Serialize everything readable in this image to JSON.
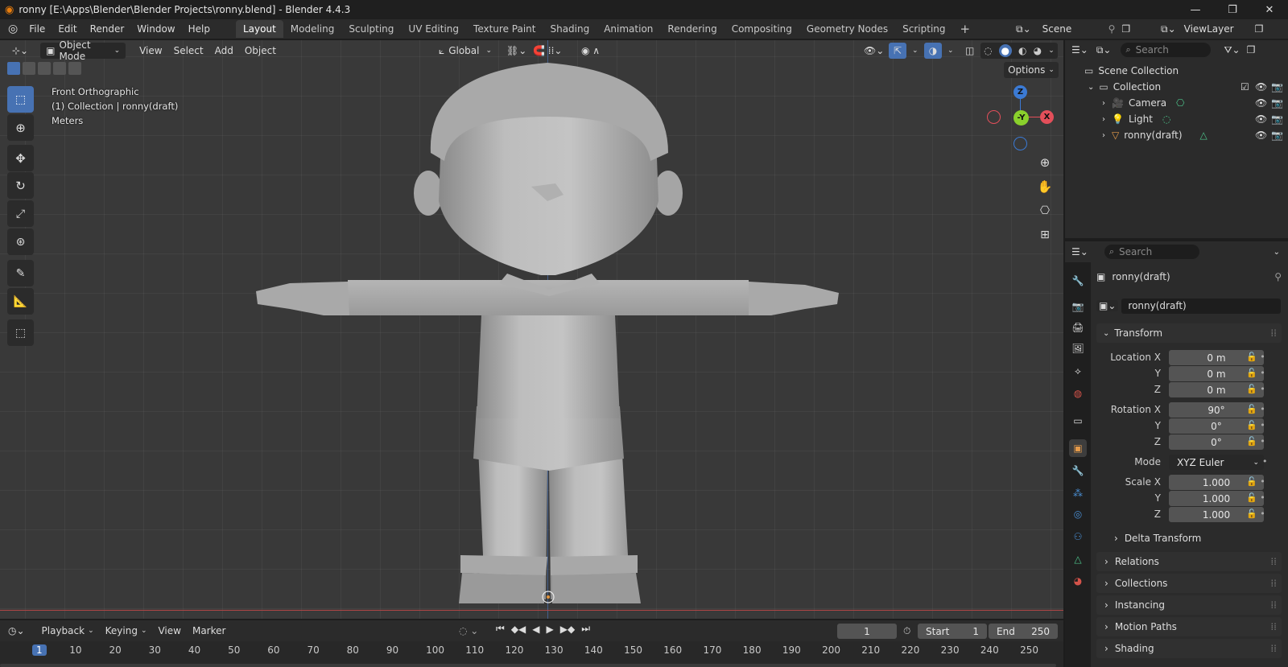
{
  "window": {
    "title": "ronny [E:\\Apps\\Blender\\Blender Projects\\ronny.blend] - Blender 4.4.3",
    "minimize": "—",
    "maximize": "❐",
    "close": "✕"
  },
  "menubar": {
    "items": [
      "File",
      "Edit",
      "Render",
      "Window",
      "Help"
    ],
    "workspaces": [
      "Layout",
      "Modeling",
      "Sculpting",
      "UV Editing",
      "Texture Paint",
      "Shading",
      "Animation",
      "Rendering",
      "Compositing",
      "Geometry Nodes",
      "Scripting"
    ],
    "active_workspace": "Layout",
    "add_workspace": "+",
    "scene": "Scene",
    "view_layer": "ViewLayer"
  },
  "viewport": {
    "mode": "Object Mode",
    "menus": [
      "View",
      "Select",
      "Add",
      "Object"
    ],
    "orientation": "Global",
    "options": "Options",
    "info_line1": "Front Orthographic",
    "info_line2": "(1) Collection | ronny(draft)",
    "info_line3": "Meters",
    "gizmo": {
      "z": "Z",
      "y": "-Y",
      "x": "X"
    }
  },
  "outliner": {
    "search_placeholder": "Search",
    "scene_collection": "Scene Collection",
    "collection": "Collection",
    "objects": [
      "Camera",
      "Light",
      "ronny(draft)"
    ]
  },
  "properties": {
    "search_placeholder": "Search",
    "object_name": "ronny(draft)",
    "data_name": "ronny(draft)",
    "transform_label": "Transform",
    "location_label": "Location X",
    "rotation_label": "Rotation X",
    "scale_label": "Scale X",
    "y_label": "Y",
    "z_label": "Z",
    "location": [
      "0 m",
      "0 m",
      "0 m"
    ],
    "rotation": [
      "90°",
      "0°",
      "0°"
    ],
    "mode_label": "Mode",
    "mode_value": "XYZ Euler",
    "scale": [
      "1.000",
      "1.000",
      "1.000"
    ],
    "delta_transform": "Delta Transform",
    "panels": [
      "Relations",
      "Collections",
      "Instancing",
      "Motion Paths",
      "Shading"
    ]
  },
  "timeline": {
    "menus": [
      "Playback",
      "Keying",
      "View",
      "Marker"
    ],
    "current_frame": "1",
    "start_label": "Start",
    "start_value": "1",
    "end_label": "End",
    "end_value": "250",
    "frame_markers": [
      "1",
      "10",
      "20",
      "30",
      "40",
      "50",
      "60",
      "70",
      "80",
      "90",
      "100",
      "110",
      "120",
      "130",
      "140",
      "150",
      "160",
      "170",
      "180",
      "190",
      "200",
      "210",
      "220",
      "230",
      "240",
      "250"
    ]
  },
  "colors": {
    "accent": "#4772b3",
    "gizmo_x": "#e34f5a",
    "gizmo_y": "#8ad12c",
    "gizmo_z": "#3b7ad4",
    "camera_icon": "#e59a4a",
    "mesh_icon": "#4cc28a"
  }
}
